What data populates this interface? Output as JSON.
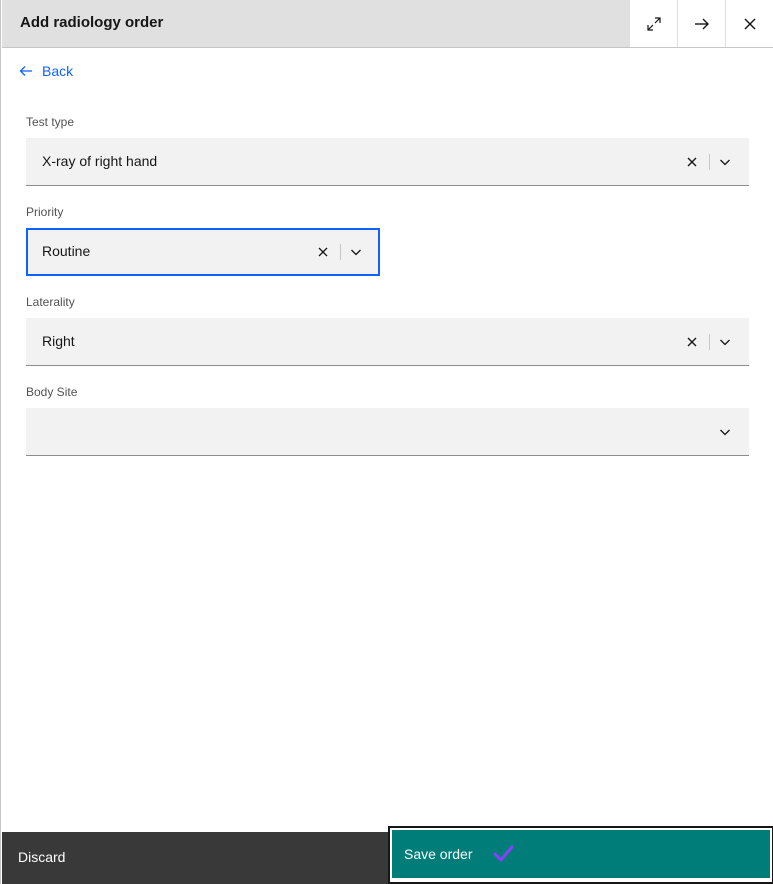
{
  "header": {
    "title": "Add radiology order",
    "buttons": [
      "maximize-icon",
      "arrow-right-icon",
      "close-icon"
    ]
  },
  "back": {
    "label": "Back"
  },
  "fields": {
    "test_type": {
      "label": "Test type",
      "value": "X-ray of right hand"
    },
    "priority": {
      "label": "Priority",
      "value": "Routine"
    },
    "laterality": {
      "label": "Laterality",
      "value": "Right"
    },
    "body_site": {
      "label": "Body Site",
      "value": ""
    }
  },
  "footer": {
    "discard_label": "Discard",
    "save_label": "Save order"
  },
  "colors": {
    "header_bg": "#e0e0e0",
    "link": "#0f62fe",
    "focus": "#0f62fe",
    "field_bg": "#f2f2f2",
    "discard_bg": "#393939",
    "save_bg": "#007d79",
    "checkmark": "#8a3ffc"
  }
}
